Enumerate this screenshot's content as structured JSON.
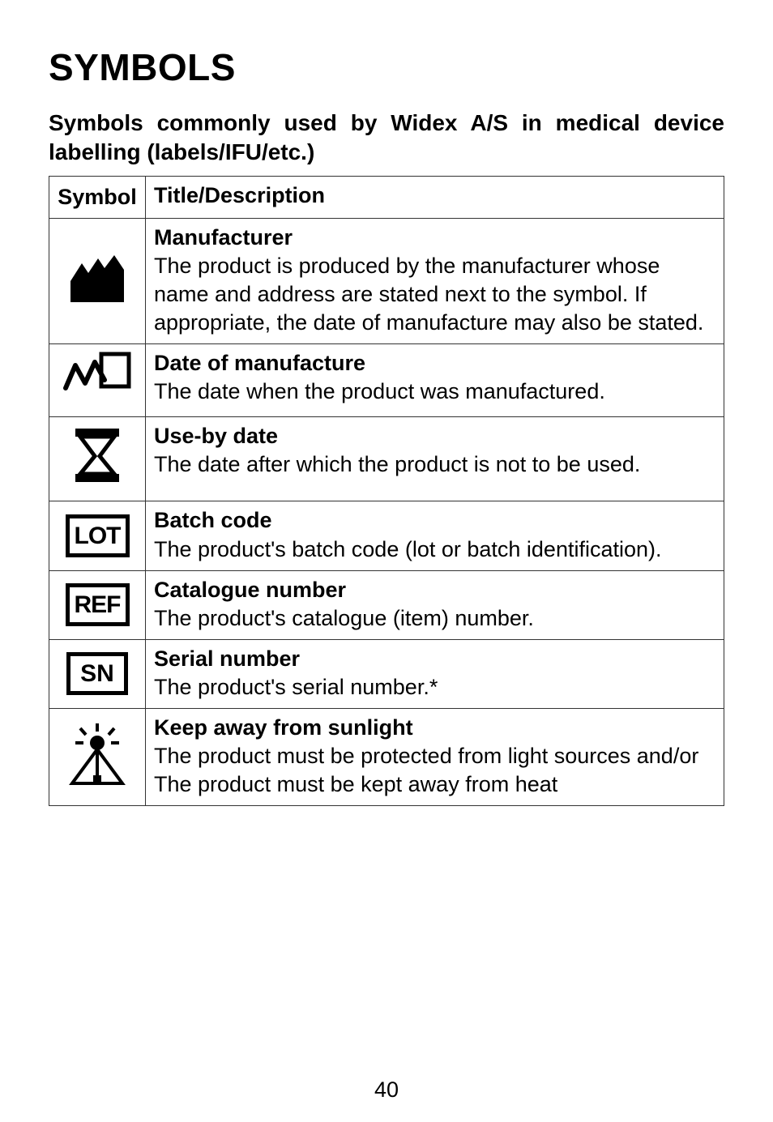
{
  "heading": "SYMBOLS",
  "intro": "Symbols commonly used by Widex A/S in medical device labelling (labels/IFU/etc.)",
  "table": {
    "header": {
      "c1": "Symbol",
      "c2": "Title/Description"
    },
    "rows": [
      {
        "icon": "manufacturer",
        "title": "Manufacturer",
        "desc": "The product is produced by the manufacturer whose name and address are stated next to the symbol. If appropriate, the date of manufacture may also be stated."
      },
      {
        "icon": "date-of-manufacture",
        "title": "Date of manufacture",
        "desc": "The date when the product was manufactured."
      },
      {
        "icon": "use-by-date",
        "title": "Use-by date",
        "desc": "The date after which the product is not to be used."
      },
      {
        "icon": "lot",
        "title": "Batch code",
        "desc": "The product's batch code (lot or batch identification)."
      },
      {
        "icon": "ref",
        "title": "Catalogue number",
        "desc": "The product's catalogue (item) number."
      },
      {
        "icon": "sn",
        "title": "Serial number",
        "desc": "The product's serial number.*"
      },
      {
        "icon": "keep-away-sunlight",
        "title": "Keep away from sunlight",
        "desc": "The product must be protected from light sources and/or The product must be kept away from heat"
      }
    ]
  },
  "pageNumber": "40",
  "iconText": {
    "lot": "LOT",
    "ref": "REF",
    "sn": "SN"
  }
}
